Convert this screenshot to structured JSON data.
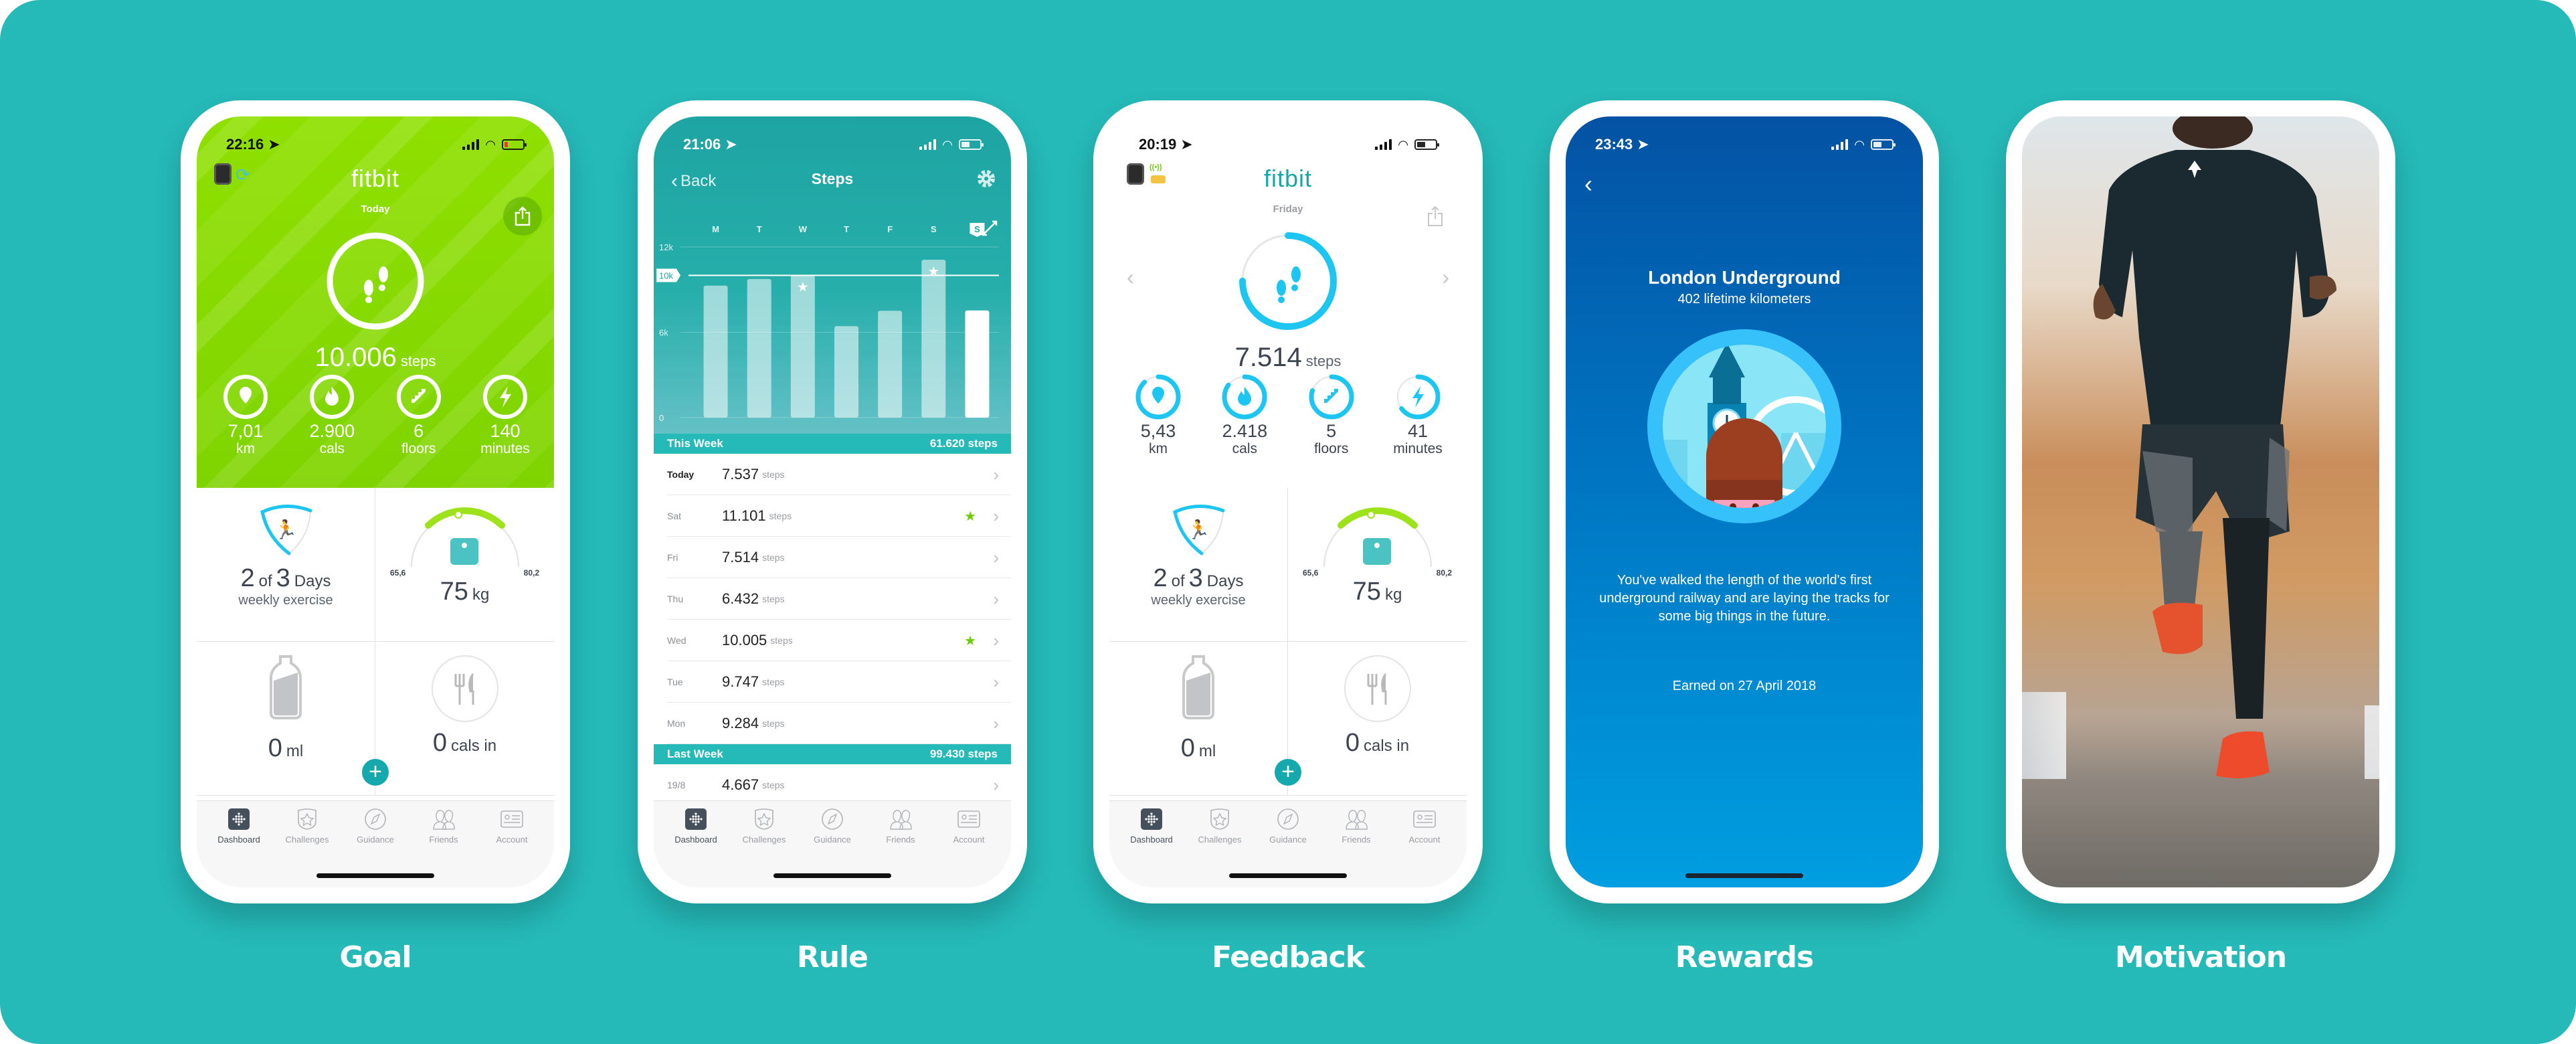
{
  "theme": {
    "background": "#25b9b8",
    "goal_green": "#8fe000",
    "teal": "#1ea5a3",
    "accent_blue": "#1cc6f0",
    "reward_blue": "#0452a4",
    "star_green": "#6ccc00"
  },
  "labels": [
    "Goal",
    "Rule",
    "Feedback",
    "Rewards",
    "Motivation"
  ],
  "tabbar": [
    {
      "label": "Dashboard",
      "icon": "fitbit-dots-icon"
    },
    {
      "label": "Challenges",
      "icon": "star-shield-icon"
    },
    {
      "label": "Guidance",
      "icon": "compass-icon"
    },
    {
      "label": "Friends",
      "icon": "friends-icon"
    },
    {
      "label": "Account",
      "icon": "id-card-icon"
    }
  ],
  "goal": {
    "time": "22:16",
    "brand": "fitbit",
    "day": "Today",
    "steps_value": "10.006",
    "steps_unit": "steps",
    "steps_progress": 1.0,
    "stats": [
      {
        "icon": "location-pin-icon",
        "value": "7,01",
        "unit": "km",
        "progress": 1.0
      },
      {
        "icon": "flame-icon",
        "value": "2.900",
        "unit": "cals",
        "progress": 1.0
      },
      {
        "icon": "stairs-icon",
        "value": "6",
        "unit": "floors",
        "progress": 1.0
      },
      {
        "icon": "lightning-icon",
        "value": "140",
        "unit": "minutes",
        "progress": 1.0
      }
    ],
    "exercise": {
      "done": "2",
      "of": "of",
      "goal": "3",
      "unit": "Days",
      "label": "weekly exercise",
      "progress": 0.67
    },
    "weight": {
      "min": "65,6",
      "max": "80,2",
      "value": "75",
      "unit": "kg"
    },
    "water": {
      "value": "0",
      "unit": "ml"
    },
    "food": {
      "value": "0",
      "unit": "cals in"
    },
    "add_label": "+"
  },
  "rule": {
    "time": "21:06",
    "back_label": "Back",
    "title": "Steps",
    "this_week": {
      "label": "This Week",
      "total": "61.620 steps"
    },
    "last_week": {
      "label": "Last Week",
      "total": "99.430 steps"
    },
    "rows": [
      {
        "day": "Today",
        "value": "7.537",
        "unit": "steps",
        "star": false,
        "today": true
      },
      {
        "day": "Sat",
        "value": "11.101",
        "unit": "steps",
        "star": true,
        "today": false
      },
      {
        "day": "Fri",
        "value": "7.514",
        "unit": "steps",
        "star": false,
        "today": false
      },
      {
        "day": "Thu",
        "value": "6.432",
        "unit": "steps",
        "star": false,
        "today": false
      },
      {
        "day": "Wed",
        "value": "10.005",
        "unit": "steps",
        "star": true,
        "today": false
      },
      {
        "day": "Tue",
        "value": "9.747",
        "unit": "steps",
        "star": false,
        "today": false
      },
      {
        "day": "Mon",
        "value": "9.284",
        "unit": "steps",
        "star": false,
        "today": false
      }
    ],
    "last_rows": [
      {
        "day": "19/8",
        "value": "4.667",
        "unit": "steps"
      }
    ]
  },
  "chart_data": {
    "type": "bar",
    "title": "Steps",
    "categories": [
      "M",
      "T",
      "W",
      "T",
      "F",
      "S",
      "S"
    ],
    "values": [
      9284,
      9747,
      10005,
      6432,
      7514,
      11101,
      7537
    ],
    "goal_line": 10000,
    "goal_label": "10k",
    "starred": [
      false,
      false,
      true,
      false,
      false,
      true,
      false
    ],
    "highlight_index": 6,
    "yticks": [
      0,
      6000,
      12000
    ],
    "ytick_labels": [
      "0",
      "6k",
      "12k"
    ],
    "ylim": [
      0,
      12000
    ],
    "xlabel": "",
    "ylabel": "",
    "grid": true
  },
  "feedback": {
    "time": "20:19",
    "brand": "fitbit",
    "day": "Friday",
    "steps_value": "7.514",
    "steps_unit": "steps",
    "steps_progress": 0.75,
    "stats": [
      {
        "icon": "location-pin-icon",
        "value": "5,43",
        "unit": "km",
        "progress": 0.88
      },
      {
        "icon": "flame-icon",
        "value": "2.418",
        "unit": "cals",
        "progress": 0.85
      },
      {
        "icon": "stairs-icon",
        "value": "5",
        "unit": "floors",
        "progress": 0.8
      },
      {
        "icon": "lightning-icon",
        "value": "41",
        "unit": "minutes",
        "progress": 0.65
      }
    ],
    "exercise": {
      "done": "2",
      "of": "of",
      "goal": "3",
      "unit": "Days",
      "label": "weekly exercise",
      "progress": 0.67
    },
    "weight": {
      "min": "65,6",
      "max": "80,2",
      "value": "75",
      "unit": "kg"
    },
    "water": {
      "value": "0",
      "unit": "ml"
    },
    "food": {
      "value": "0",
      "unit": "cals in"
    },
    "add_label": "+"
  },
  "rewards": {
    "time": "23:43",
    "title": "London Underground",
    "subtitle": "402 lifetime kilometers",
    "description": "You've walked the length of the world's first underground railway and are laying the tracks for some big things in the future.",
    "earned": "Earned on 27 April 2018"
  },
  "motivation": {
    "photo_description": "runner in black sportswear and orange shoes"
  }
}
